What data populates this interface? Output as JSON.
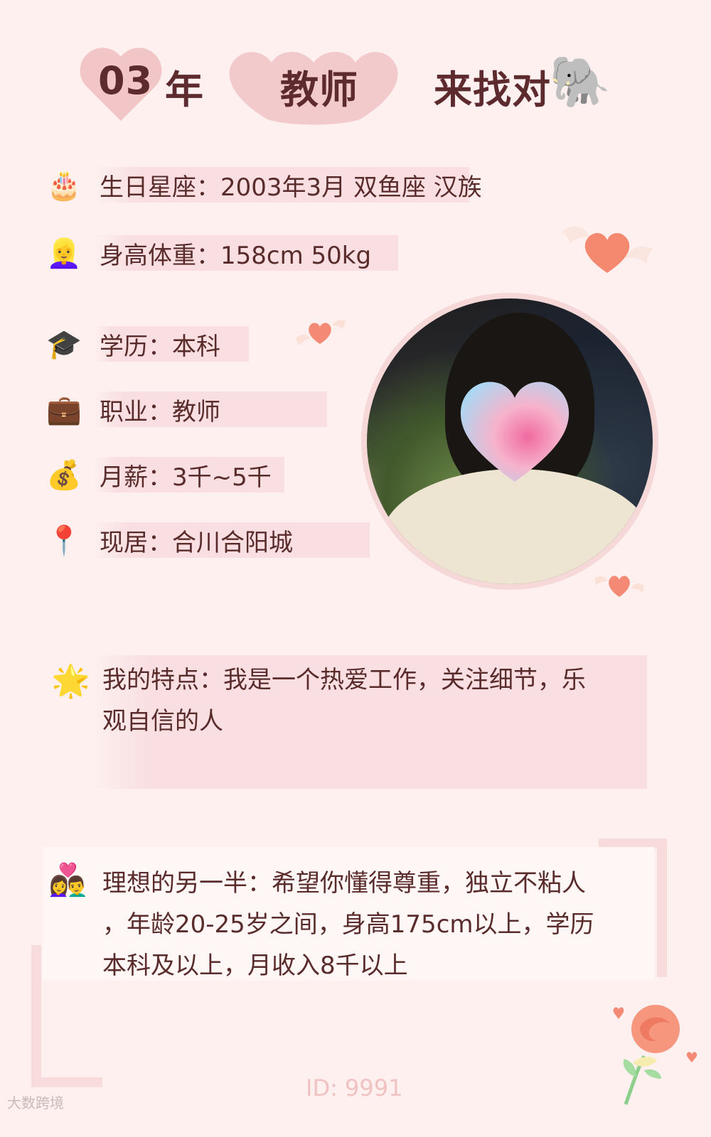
{
  "header": {
    "year": "03",
    "year_suffix": "年",
    "profession": "教师",
    "looking_for": "来找对",
    "elephant_icon": "elephant-emoji"
  },
  "profile": [
    {
      "icon": "birthday-cake-icon",
      "emoji": "🎂",
      "text": "生日星座：2003年3月 双鱼座 汉族"
    },
    {
      "icon": "woman-icon",
      "emoji": "👱‍♀️",
      "text": "身高体重：158cm 50kg"
    },
    {
      "icon": "graduation-cap-icon",
      "emoji": "🎓",
      "text": "学历：本科"
    },
    {
      "icon": "briefcase-icon",
      "emoji": "💼",
      "text": "职业：教师"
    },
    {
      "icon": "money-bag-icon",
      "emoji": "💰",
      "text": "月薪：3千~5千"
    },
    {
      "icon": "location-pin-icon",
      "emoji": "📍",
      "text": "现居：合川合阳城"
    }
  ],
  "features": {
    "icon": "star-icon",
    "emoji": "🌟",
    "line1": "我的特点：我是一个热爱工作，关注细节，乐",
    "line2": "观自信的人"
  },
  "ideal": {
    "icon": "couple-heart-icon",
    "emoji": "👩‍❤️‍👨",
    "line1": "理想的另一半：希望你懂得尊重，独立不粘人",
    "line2": "，年龄20-25岁之间，身高175cm以上，学历",
    "line3": "本科及以上，月收入8千以上"
  },
  "footer": {
    "id": "ID: 9991",
    "watermark": "大数跨境"
  },
  "colors": {
    "background": "#fdf0ef",
    "highlight": "#f9dfe1",
    "heading": "#5d2a2e",
    "heart": "#f2c6c6",
    "accent_heart": "#f07c6c"
  }
}
